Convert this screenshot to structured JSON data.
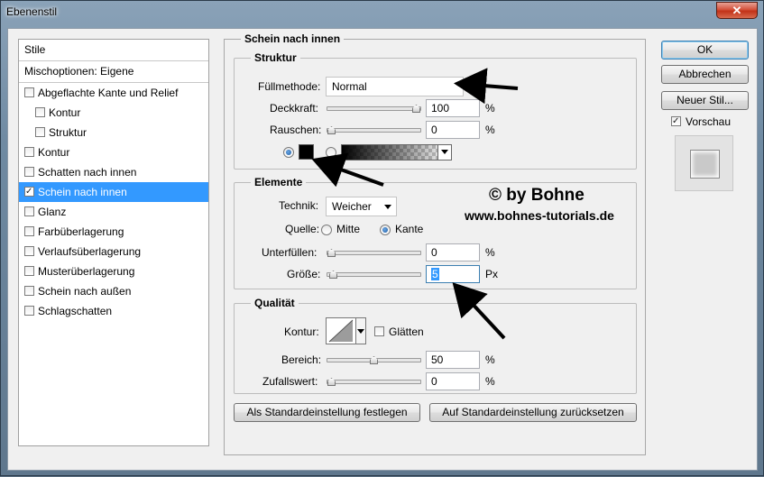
{
  "window": {
    "title": "Ebenenstil",
    "close_label": "✕"
  },
  "sidebar": {
    "header": "Stile",
    "blend_options": "Mischoptionen: Eigene",
    "items": [
      {
        "label": "Abgeflachte Kante und Relief",
        "checked": false,
        "indent": false
      },
      {
        "label": "Kontur",
        "checked": false,
        "indent": true
      },
      {
        "label": "Struktur",
        "checked": false,
        "indent": true
      },
      {
        "label": "Kontur",
        "checked": false,
        "indent": false
      },
      {
        "label": "Schatten nach innen",
        "checked": false,
        "indent": false
      },
      {
        "label": "Schein nach innen",
        "checked": true,
        "indent": false,
        "selected": true
      },
      {
        "label": "Glanz",
        "checked": false,
        "indent": false
      },
      {
        "label": "Farbüberlagerung",
        "checked": false,
        "indent": false
      },
      {
        "label": "Verlaufsüberlagerung",
        "checked": false,
        "indent": false
      },
      {
        "label": "Musterüberlagerung",
        "checked": false,
        "indent": false
      },
      {
        "label": "Schein nach außen",
        "checked": false,
        "indent": false
      },
      {
        "label": "Schlagschatten",
        "checked": false,
        "indent": false
      }
    ]
  },
  "panel": {
    "title": "Schein nach innen",
    "structure": {
      "title": "Struktur",
      "blend_mode_label": "Füllmethode:",
      "blend_mode_value": "Normal",
      "opacity_label": "Deckkraft:",
      "opacity_value": "100",
      "opacity_level": 1.0,
      "opacity_unit": "%",
      "noise_label": "Rauschen:",
      "noise_value": "0",
      "noise_level": 0.0,
      "noise_unit": "%",
      "color_mode": "solid",
      "color": "#000000"
    },
    "elements": {
      "title": "Elemente",
      "technique_label": "Technik:",
      "technique_value": "Weicher",
      "source_label": "Quelle:",
      "source_center": "Mitte",
      "source_edge": "Kante",
      "source_selected": "Kante",
      "choke_label": "Unterfüllen:",
      "choke_value": "0",
      "choke_level": 0.0,
      "choke_unit": "%",
      "size_label": "Größe:",
      "size_value": "5",
      "size_level": 0.02,
      "size_unit": "Px"
    },
    "quality": {
      "title": "Qualität",
      "contour_label": "Kontur:",
      "antialias_label": "Glätten",
      "antialias_checked": false,
      "range_label": "Bereich:",
      "range_value": "50",
      "range_level": 0.5,
      "range_unit": "%",
      "jitter_label": "Zufallswert:",
      "jitter_value": "0",
      "jitter_level": 0.0,
      "jitter_unit": "%"
    },
    "make_default": "Als Standardeinstellung festlegen",
    "reset_default": "Auf Standardeinstellung zurücksetzen"
  },
  "watermark": {
    "line1": "© by Bohne",
    "line2": "www.bohnes-tutorials.de"
  },
  "actions": {
    "ok": "OK",
    "cancel": "Abbrechen",
    "new_style": "Neuer Stil...",
    "preview_label": "Vorschau",
    "preview_checked": true
  }
}
